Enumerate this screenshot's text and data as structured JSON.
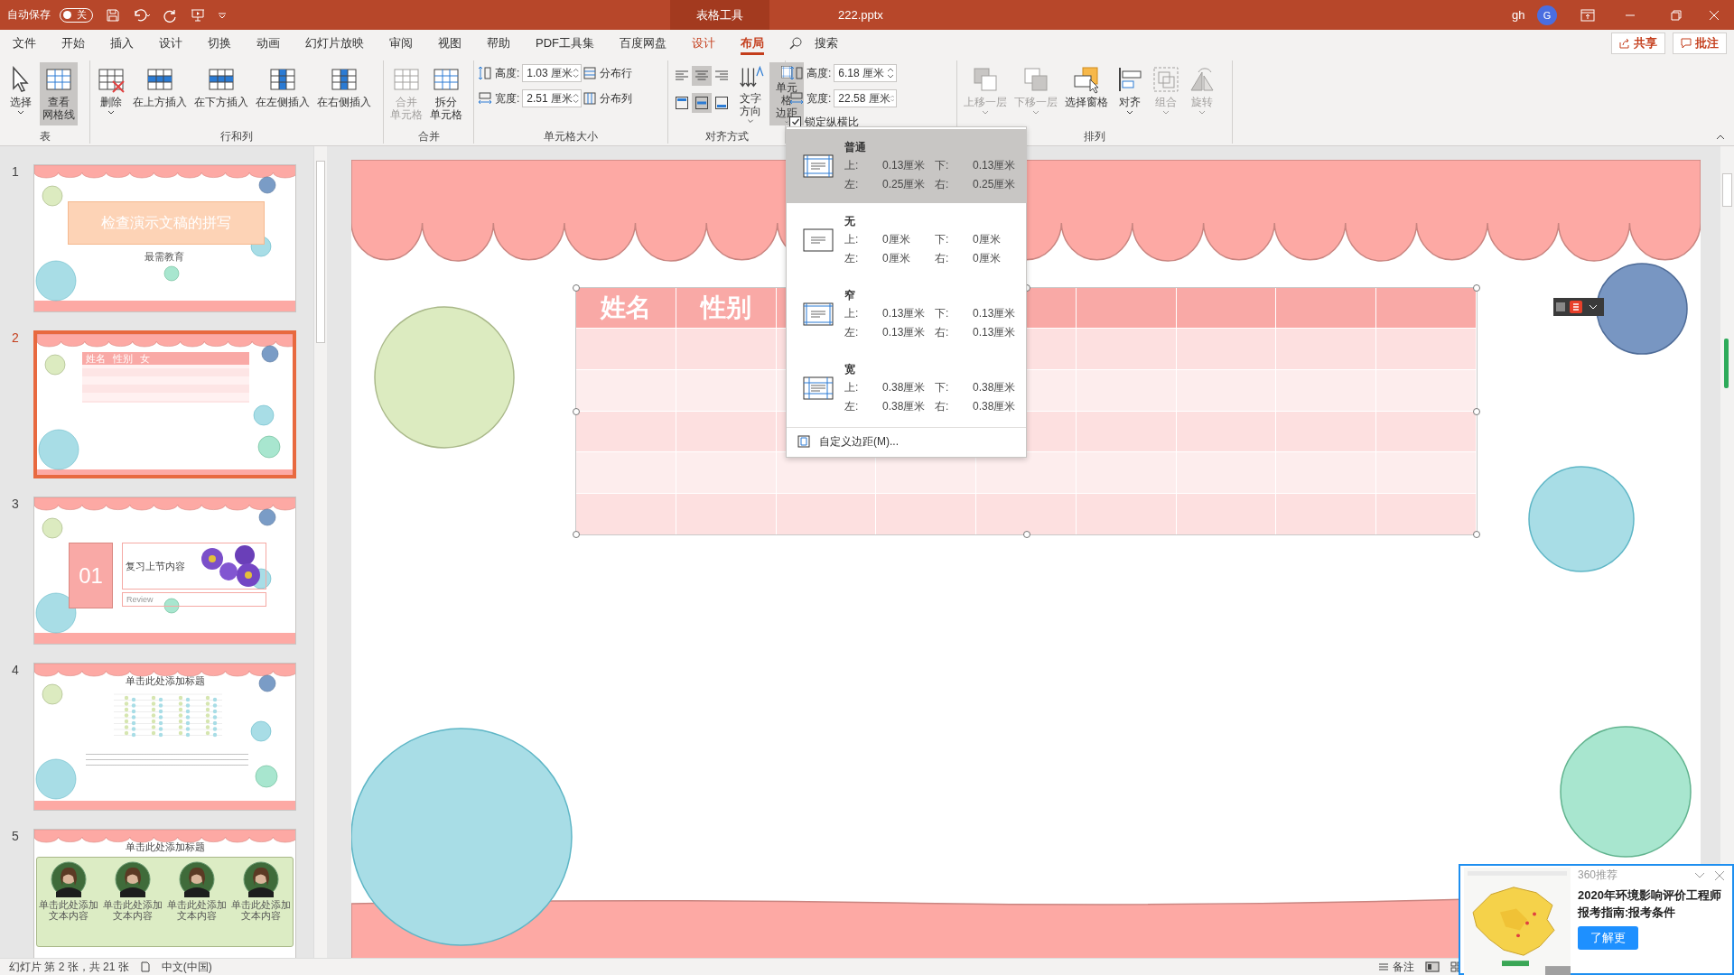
{
  "title_bar": {
    "autosave_label": "自动保存",
    "autosave": {
      "on": false,
      "label": "关"
    },
    "context_label": "表格工具",
    "filename": "222.pptx",
    "user": "gh",
    "avatar": "G"
  },
  "menu_tabs": [
    {
      "label": "文件",
      "kind": "normal",
      "selected": false
    },
    {
      "label": "开始",
      "kind": "normal",
      "selected": false
    },
    {
      "label": "插入",
      "kind": "normal",
      "selected": false
    },
    {
      "label": "设计",
      "kind": "normal",
      "selected": false
    },
    {
      "label": "切换",
      "kind": "normal",
      "selected": false
    },
    {
      "label": "动画",
      "kind": "normal",
      "selected": false
    },
    {
      "label": "幻灯片放映",
      "kind": "normal",
      "selected": false
    },
    {
      "label": "审阅",
      "kind": "normal",
      "selected": false
    },
    {
      "label": "视图",
      "kind": "normal",
      "selected": false
    },
    {
      "label": "帮助",
      "kind": "normal",
      "selected": false
    },
    {
      "label": "PDF工具集",
      "kind": "normal",
      "selected": false
    },
    {
      "label": "百度网盘",
      "kind": "normal",
      "selected": false
    },
    {
      "label": "设计",
      "kind": "contextual",
      "selected": false
    },
    {
      "label": "布局",
      "kind": "contextual",
      "selected": true
    }
  ],
  "search": "搜索",
  "share_button": "共享",
  "comments_button": "批注",
  "ribbon_groups": [
    {
      "label": "表",
      "columns": [
        [
          {
            "kind": "large",
            "label": "选择",
            "dropdown": true,
            "disabled": false,
            "pressed": false
          }
        ],
        [
          {
            "kind": "large",
            "lines": [
              "查看",
              "网格线"
            ],
            "dropdown": false,
            "disabled": false,
            "pressed": true
          }
        ]
      ]
    },
    {
      "label": "行和列",
      "columns": [
        [
          {
            "kind": "large",
            "label": "删除",
            "dropdown": true,
            "disabled": false,
            "pressed": false
          }
        ],
        [
          {
            "kind": "large",
            "label": "在上方插入",
            "dropdown": false,
            "disabled": false,
            "pressed": false
          }
        ],
        [
          {
            "kind": "large",
            "label": "在下方插入",
            "dropdown": false,
            "disabled": false,
            "pressed": false
          }
        ],
        [
          {
            "kind": "large",
            "label": "在左侧插入",
            "dropdown": false,
            "disabled": false,
            "pressed": false
          }
        ],
        [
          {
            "kind": "large",
            "label": "在右侧插入",
            "dropdown": false,
            "disabled": false,
            "pressed": false
          }
        ]
      ]
    },
    {
      "label": "合并",
      "columns": [
        [
          {
            "kind": "large",
            "lines": [
              "合并",
              "单元格"
            ],
            "dropdown": false,
            "disabled": true,
            "pressed": false
          }
        ],
        [
          {
            "kind": "large",
            "lines": [
              "拆分",
              "单元格"
            ],
            "dropdown": false,
            "disabled": false,
            "pressed": false
          }
        ]
      ]
    },
    {
      "label": "单元格大小",
      "columns": [
        [
          {
            "kind": "field",
            "label": "高度:",
            "value": "1.03 厘米"
          },
          {
            "kind": "field",
            "label": "宽度:",
            "value": "2.51 厘米"
          }
        ],
        [
          {
            "kind": "small",
            "label": "分布行"
          },
          {
            "kind": "small",
            "label": "分布列"
          }
        ]
      ]
    },
    {
      "label": "对齐方式",
      "columns": [
        [
          {
            "kind": "align",
            "selected": false
          },
          {
            "kind": "align",
            "selected": true
          },
          {
            "kind": "align",
            "selected": false
          },
          {
            "kind": "align",
            "selected": false
          },
          {
            "kind": "align",
            "selected": true
          },
          {
            "kind": "align",
            "selected": false
          }
        ],
        [
          {
            "kind": "large",
            "label": "文字方向",
            "dropdown": true,
            "disabled": false,
            "pressed": false
          }
        ],
        [
          {
            "kind": "large",
            "lines": [
              "单元格",
              "边距"
            ],
            "dropdown": true,
            "disabled": false,
            "pressed": true
          }
        ]
      ]
    },
    {
      "columns": [
        [
          {
            "kind": "field",
            "label": "高度:",
            "value": "6.18 厘米"
          },
          {
            "kind": "field",
            "label": "宽度:",
            "value": "22.58 厘米"
          },
          {
            "kind": "checkbox",
            "label": "锁定纵横比",
            "checked": true
          }
        ]
      ]
    },
    {
      "label": "排列",
      "columns": [
        [
          {
            "kind": "large",
            "label": "上移一层",
            "dropdown": true,
            "disabled": true,
            "pressed": false
          }
        ],
        [
          {
            "kind": "large",
            "label": "下移一层",
            "dropdown": true,
            "disabled": true,
            "pressed": false
          }
        ],
        [
          {
            "kind": "large",
            "label": "选择窗格",
            "dropdown": false,
            "disabled": false,
            "pressed": false
          }
        ],
        [
          {
            "kind": "large",
            "label": "对齐",
            "dropdown": true,
            "disabled": false,
            "pressed": false
          }
        ],
        [
          {
            "kind": "large",
            "label": "组合",
            "dropdown": true,
            "disabled": true,
            "pressed": false
          }
        ],
        [
          {
            "kind": "large",
            "label": "旋转",
            "dropdown": true,
            "disabled": true,
            "pressed": false
          }
        ]
      ]
    }
  ],
  "margins_menu": {
    "options": [
      {
        "name": "普通",
        "selected": true,
        "margins": [
          {
            "label": "上:",
            "value": "0.13厘米"
          },
          {
            "label": "下:",
            "value": "0.13厘米"
          },
          {
            "label": "左:",
            "value": "0.25厘米"
          },
          {
            "label": "右:",
            "value": "0.25厘米"
          }
        ]
      },
      {
        "name": "无",
        "selected": false,
        "margins": [
          {
            "label": "上:",
            "value": "0厘米"
          },
          {
            "label": "下:",
            "value": "0厘米"
          },
          {
            "label": "左:",
            "value": "0厘米"
          },
          {
            "label": "右:",
            "value": "0厘米"
          }
        ]
      },
      {
        "name": "窄",
        "selected": false,
        "margins": [
          {
            "label": "上:",
            "value": "0.13厘米"
          },
          {
            "label": "下:",
            "value": "0.13厘米"
          },
          {
            "label": "左:",
            "value": "0.13厘米"
          },
          {
            "label": "右:",
            "value": "0.13厘米"
          }
        ]
      },
      {
        "name": "宽",
        "selected": false,
        "margins": [
          {
            "label": "上:",
            "value": "0.38厘米"
          },
          {
            "label": "下:",
            "value": "0.38厘米"
          },
          {
            "label": "左:",
            "value": "0.38厘米"
          },
          {
            "label": "右:",
            "value": "0.38厘米"
          }
        ]
      }
    ],
    "custom": "自定义边距(M)..."
  },
  "thumbnails": [
    {
      "number": "1",
      "selected": false,
      "kind": "title",
      "title": "检查演示文稿的拼写",
      "subtitle": "最需教育"
    },
    {
      "number": "2",
      "selected": true,
      "kind": "table",
      "headers": [
        "姓名",
        "性别",
        "女"
      ]
    },
    {
      "number": "3",
      "selected": false,
      "kind": "section",
      "index": "01",
      "title": "复习上节内容",
      "subtitle": "Review"
    },
    {
      "number": "4",
      "selected": false,
      "kind": "chart",
      "title": "单击此处添加标题"
    },
    {
      "number": "5",
      "selected": false,
      "kind": "gallery",
      "title": "单击此处添加标题",
      "captions": [
        "单击此处添加文本内容",
        "单击此处添加文本内容",
        "单击此处添加文本内容",
        "单击此处添加文本内容"
      ]
    }
  ],
  "slide": {
    "table_headers": [
      "姓名",
      "性别"
    ]
  },
  "status_bar": {
    "slide_info": "幻灯片 第 2 张，共 21 张",
    "language": "中文(中国)",
    "notes_button": "备注"
  },
  "ad_popup": {
    "source": "360推荐",
    "headline": "2020年环境影响评价工程师报考指南:报考条件",
    "button": "了解更"
  }
}
